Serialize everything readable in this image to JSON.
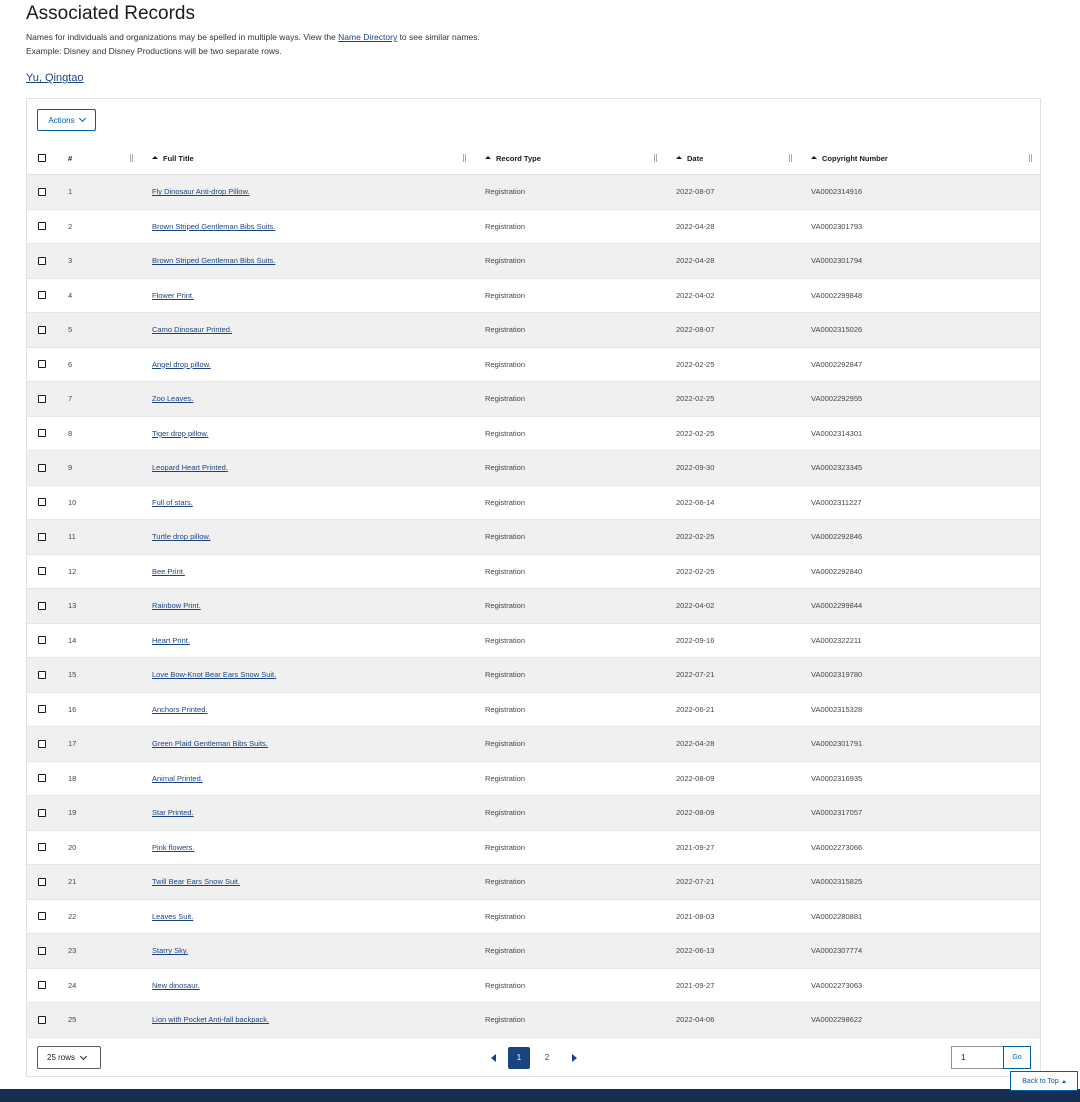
{
  "page": {
    "title": "Associated Records",
    "desc_prefix": "Names for individuals and organizations may be spelled in multiple ways. View the ",
    "desc_link": "Name Directory",
    "desc_suffix": " to see similar names.",
    "desc_line2": "Example: Disney and Disney Productions will be two separate rows.",
    "name_link": "Yu, Qingtao"
  },
  "toolbar": {
    "actions_label": "Actions"
  },
  "table": {
    "columns": {
      "num": "#",
      "title": "Full Title",
      "type": "Record Type",
      "date": "Date",
      "copyright": "Copyright Number"
    },
    "rows": [
      {
        "num": "1",
        "title": "Fly Dinosaur Anti-drop Pillow.",
        "type": "Registration",
        "date": "2022-08-07",
        "copyright": "VA0002314916"
      },
      {
        "num": "2",
        "title": "Brown Striped Gentleman Bibs Suits.",
        "type": "Registration",
        "date": "2022-04-28",
        "copyright": "VA0002301793"
      },
      {
        "num": "3",
        "title": "Brown Striped Gentleman Bibs Suits.",
        "type": "Registration",
        "date": "2022-04-28",
        "copyright": "VA0002301794"
      },
      {
        "num": "4",
        "title": "Flower Print.",
        "type": "Registration",
        "date": "2022-04-02",
        "copyright": "VA0002299848"
      },
      {
        "num": "5",
        "title": "Camo Dinosaur Printed.",
        "type": "Registration",
        "date": "2022-08-07",
        "copyright": "VA0002315026"
      },
      {
        "num": "6",
        "title": "Angel drop pillow.",
        "type": "Registration",
        "date": "2022-02-25",
        "copyright": "VA0002292847"
      },
      {
        "num": "7",
        "title": "Zoo Leaves.",
        "type": "Registration",
        "date": "2022-02-25",
        "copyright": "VA0002292955"
      },
      {
        "num": "8",
        "title": "Tiger drop pillow.",
        "type": "Registration",
        "date": "2022-02-25",
        "copyright": "VA0002314301"
      },
      {
        "num": "9",
        "title": "Leopard Heart Printed.",
        "type": "Registration",
        "date": "2022-09-30",
        "copyright": "VA0002323345"
      },
      {
        "num": "10",
        "title": "Full of stars.",
        "type": "Registration",
        "date": "2022-06-14",
        "copyright": "VA0002311227"
      },
      {
        "num": "11",
        "title": "Turtle drop pillow.",
        "type": "Registration",
        "date": "2022-02-25",
        "copyright": "VA0002292846"
      },
      {
        "num": "12",
        "title": "Bee Print.",
        "type": "Registration",
        "date": "2022-02-25",
        "copyright": "VA0002292840"
      },
      {
        "num": "13",
        "title": "Rainbow Print.",
        "type": "Registration",
        "date": "2022-04-02",
        "copyright": "VA0002299844"
      },
      {
        "num": "14",
        "title": "Heart Print.",
        "type": "Registration",
        "date": "2022-09-16",
        "copyright": "VA0002322211"
      },
      {
        "num": "15",
        "title": "Love Bow-Knot Bear Ears Snow Suit.",
        "type": "Registration",
        "date": "2022-07-21",
        "copyright": "VA0002319780"
      },
      {
        "num": "16",
        "title": "Anchors Printed.",
        "type": "Registration",
        "date": "2022-06-21",
        "copyright": "VA0002315328"
      },
      {
        "num": "17",
        "title": "Green Plaid Gentleman Bibs Suits.",
        "type": "Registration",
        "date": "2022-04-28",
        "copyright": "VA0002301791"
      },
      {
        "num": "18",
        "title": "Animal Printed.",
        "type": "Registration",
        "date": "2022-08-09",
        "copyright": "VA0002316935"
      },
      {
        "num": "19",
        "title": "Star Printed.",
        "type": "Registration",
        "date": "2022-08-09",
        "copyright": "VA0002317057"
      },
      {
        "num": "20",
        "title": "Pink flowers.",
        "type": "Registration",
        "date": "2021-09-27",
        "copyright": "VA0002273066"
      },
      {
        "num": "21",
        "title": "Twill Bear Ears Snow Suit.",
        "type": "Registration",
        "date": "2022-07-21",
        "copyright": "VA0002315825"
      },
      {
        "num": "22",
        "title": "Leaves Suit.",
        "type": "Registration",
        "date": "2021-08-03",
        "copyright": "VA0002280881"
      },
      {
        "num": "23",
        "title": "Starry Sky.",
        "type": "Registration",
        "date": "2022-06-13",
        "copyright": "VA0002307774"
      },
      {
        "num": "24",
        "title": "New dinosaur.",
        "type": "Registration",
        "date": "2021-09-27",
        "copyright": "VA0002273063"
      },
      {
        "num": "25",
        "title": "Lion with Pocket Anti-fall backpack.",
        "type": "Registration",
        "date": "2022-04-06",
        "copyright": "VA0002298622"
      }
    ]
  },
  "pagination": {
    "rows_per_page": "25 rows",
    "pages": [
      "1",
      "2"
    ],
    "current_page": "1",
    "page_input_value": "1",
    "go_label": "Go"
  },
  "back_to_top": "Back to Top",
  "colors": {
    "link": "#1a4480",
    "primary": "#005ea2",
    "footer": "#162e51",
    "row_stripe": "#f0f0f0"
  }
}
